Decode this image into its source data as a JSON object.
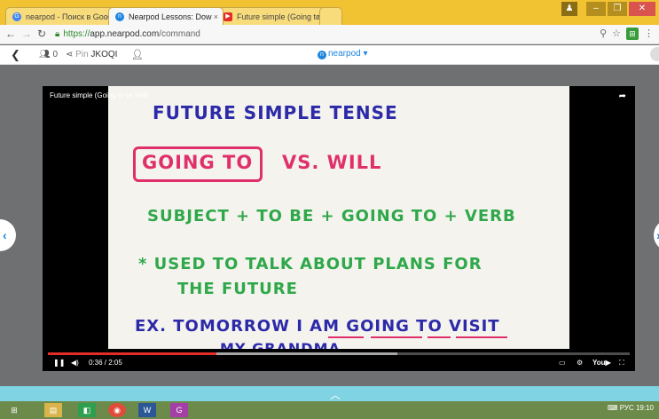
{
  "browser": {
    "tabs": [
      {
        "label": "nearpod - Поиск в Googl",
        "favicon": "G",
        "active": false
      },
      {
        "label": "Nearpod Lessons: Dow",
        "favicon": "n",
        "active": true
      },
      {
        "label": "Future simple (Going to v",
        "favicon": "▶",
        "active": false
      }
    ],
    "url_scheme": "https://",
    "url_host": "app.nearpod.com",
    "url_path": "/command"
  },
  "nearpod_toolbar": {
    "students_count": "0",
    "pin_label": "Pin",
    "pin_code": "JKOQI",
    "logo_text": "nearpod"
  },
  "video": {
    "title": "Future simple (Going to vs Will)",
    "time": "0:36 / 2:05",
    "progress_fraction": 0.29,
    "board": {
      "line1": "FUTURE SIMPLE TENSE",
      "line2a": "GOING TO",
      "line2b": "VS. WILL",
      "line3": "SUBJECT + TO BE + GOING TO + VERB",
      "line4": "* USED TO TALK ABOUT PLANS FOR",
      "line5": "THE FUTURE",
      "line6": "EX. TOMORROW I AM GOING TO VISIT",
      "line7": "MY GRANDMA"
    }
  },
  "taskbar": {
    "clock": "19:10",
    "lang": "РУС"
  }
}
